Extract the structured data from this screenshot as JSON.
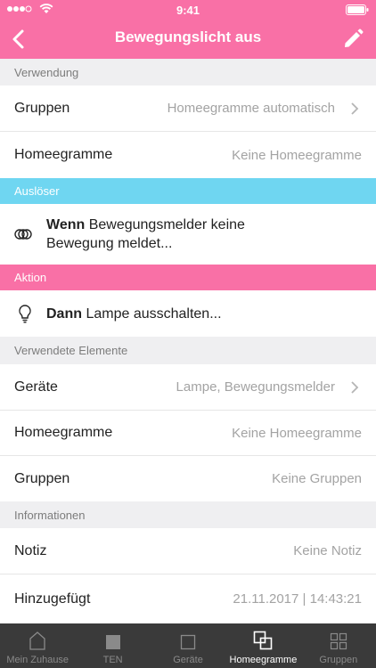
{
  "status": {
    "time": "9:41"
  },
  "nav": {
    "title": "Bewegungslicht aus"
  },
  "sections": {
    "verwendung": "Verwendung",
    "ausloeser": "Auslöser",
    "aktion": "Aktion",
    "verwendete": "Verwendete Elemente",
    "informationen": "Informationen"
  },
  "verwendung": {
    "gruppen": {
      "label": "Gruppen",
      "value": "Homeegramme automatisch"
    },
    "homeegramme": {
      "label": "Homeegramme",
      "value": "Keine Homeegramme"
    }
  },
  "trigger": {
    "keyword": "Wenn",
    "text": " Bewegungsmelder keine",
    "text2": "Bewegung meldet..."
  },
  "action": {
    "keyword": "Dann",
    "text": " Lampe ausschalten..."
  },
  "elements": {
    "geraete": {
      "label": "Geräte",
      "value": "Lampe, Bewegungsmelder"
    },
    "homeegramme": {
      "label": "Homeegramme",
      "value": "Keine Homeegramme"
    },
    "gruppen": {
      "label": "Gruppen",
      "value": "Keine Gruppen"
    }
  },
  "info": {
    "notiz": {
      "label": "Notiz",
      "value": "Keine Notiz"
    },
    "hinzugefuegt": {
      "label": "Hinzugefügt",
      "value": "21.11.2017 | 14:43:21"
    }
  },
  "tabs": [
    {
      "label": "Mein Zuhause",
      "icon": "house-icon"
    },
    {
      "label": "TEN",
      "icon": "square-filled-icon"
    },
    {
      "label": "Geräte",
      "icon": "square-outline-icon"
    },
    {
      "label": "Homeegramme",
      "icon": "homeegram-icon"
    },
    {
      "label": "Gruppen",
      "icon": "groups-icon"
    }
  ],
  "colors": {
    "header": "#f970a6",
    "trigger": "#6fd6f1",
    "tabbar": "#3a3a3a"
  }
}
